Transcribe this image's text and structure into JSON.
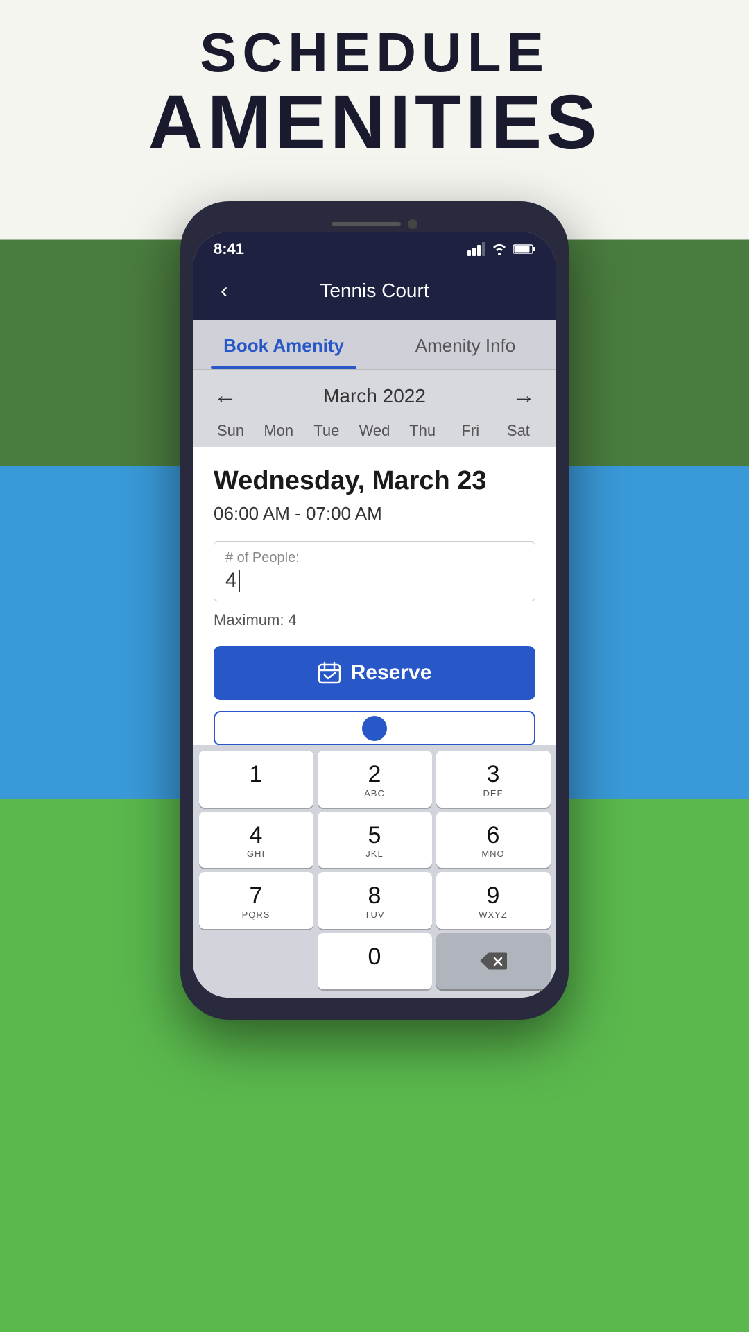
{
  "header": {
    "schedule_label": "SCHEDULE",
    "amenities_label": "AMENITIES"
  },
  "status_bar": {
    "time": "8:41",
    "location_icon": "navigation-icon"
  },
  "nav": {
    "back_label": "‹",
    "title": "Tennis Court"
  },
  "tabs": [
    {
      "id": "book",
      "label": "Book Amenity",
      "active": true
    },
    {
      "id": "info",
      "label": "Amenity Info",
      "active": false
    }
  ],
  "calendar": {
    "prev_label": "←",
    "next_label": "→",
    "month_year": "March 2022",
    "days": [
      "Sun",
      "Mon",
      "Tue",
      "Wed",
      "Thu",
      "Fri",
      "Sat"
    ]
  },
  "booking": {
    "date_label": "Wednesday, March 23",
    "time_label": "06:00 AM - 07:00 AM",
    "people_placeholder": "# of People:",
    "people_value": "4",
    "max_label": "Maximum: 4",
    "reserve_button_label": "Reserve"
  },
  "keyboard": {
    "rows": [
      [
        {
          "num": "1",
          "letters": ""
        },
        {
          "num": "2",
          "letters": "ABC"
        },
        {
          "num": "3",
          "letters": "DEF"
        }
      ],
      [
        {
          "num": "4",
          "letters": "GHI"
        },
        {
          "num": "5",
          "letters": "JKL"
        },
        {
          "num": "6",
          "letters": "MNO"
        }
      ],
      [
        {
          "num": "7",
          "letters": "PQRS"
        },
        {
          "num": "8",
          "letters": "TUV"
        },
        {
          "num": "9",
          "letters": "WXYZ"
        }
      ],
      [
        {
          "num": "",
          "letters": ""
        },
        {
          "num": "0",
          "letters": ""
        },
        {
          "num": "delete",
          "letters": ""
        }
      ]
    ]
  },
  "colors": {
    "accent_blue": "#2857c8",
    "nav_bg": "#1e2140",
    "tab_bg": "#d0d0d8"
  }
}
